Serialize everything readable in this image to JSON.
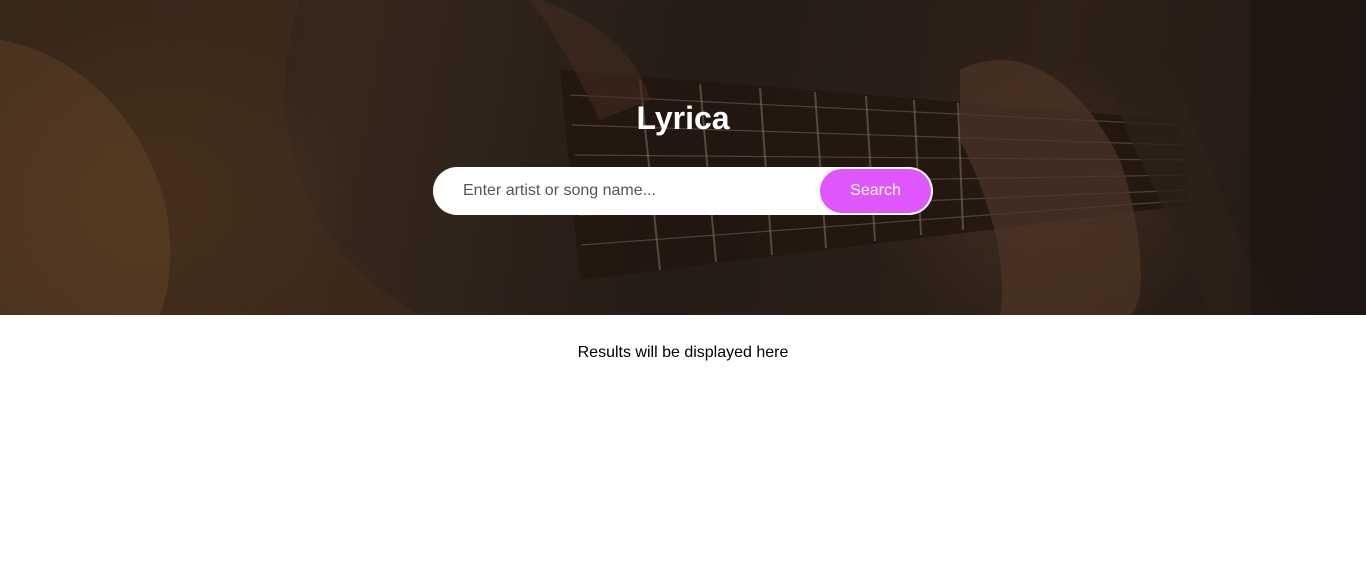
{
  "header": {
    "title": "Lyrica",
    "background_image": "guitar-photo"
  },
  "search": {
    "placeholder": "Enter artist or song name...",
    "value": "",
    "button_label": "Search"
  },
  "results": {
    "message": "Results will be displayed here"
  },
  "colors": {
    "accent": "#e056fd",
    "title_text": "#ffffff",
    "body_background": "#ffffff"
  }
}
